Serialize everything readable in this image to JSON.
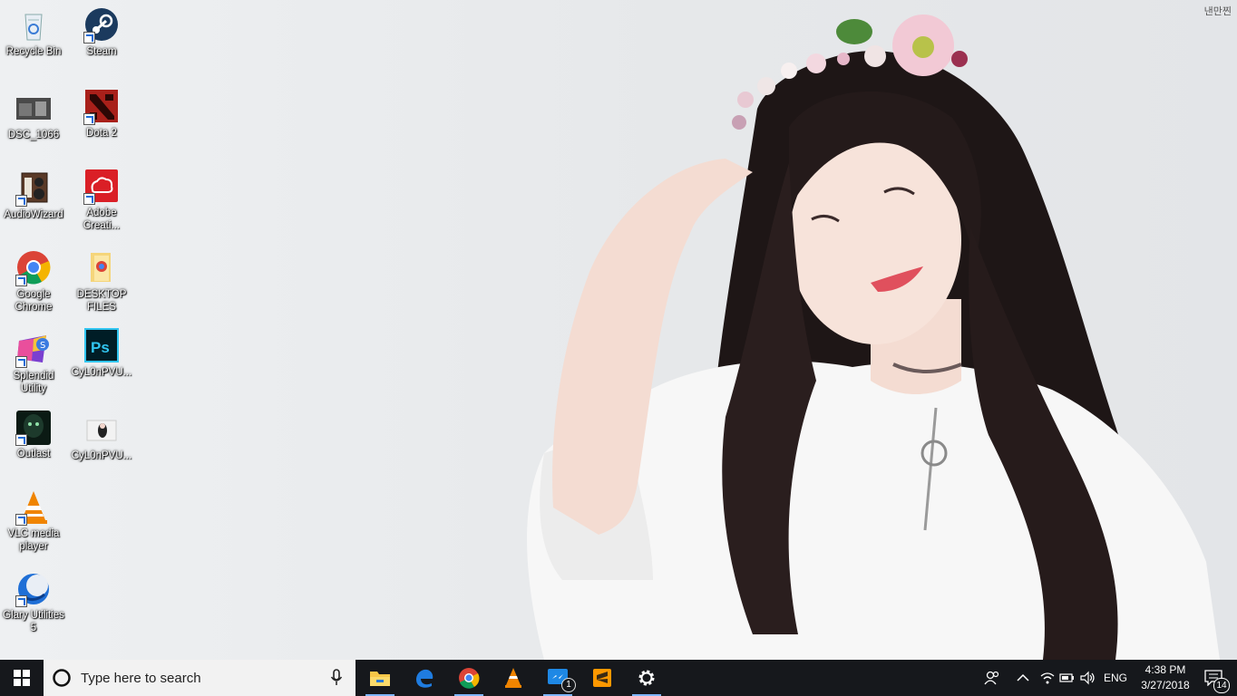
{
  "wallpaper": {
    "watermark": "낸만찐"
  },
  "desktop_icons": [
    {
      "label": "Recycle Bin",
      "icon": "recycle-bin-icon"
    },
    {
      "label": "Steam",
      "icon": "steam-icon"
    },
    {
      "label": "DSC_1066",
      "icon": "photo-thumbnail-icon"
    },
    {
      "label": "Dota 2",
      "icon": "dota2-icon"
    },
    {
      "label": "AudioWizard",
      "icon": "speaker-icon"
    },
    {
      "label": "Adobe Creati...",
      "icon": "adobe-cc-icon"
    },
    {
      "label": "Google Chrome",
      "icon": "chrome-icon"
    },
    {
      "label": "DESKTOP FILES",
      "icon": "folder-icon"
    },
    {
      "label": "Splendid Utility",
      "icon": "splendid-icon"
    },
    {
      "label": "CyL0nPVU...",
      "icon": "photoshop-icon"
    },
    {
      "label": "Outlast",
      "icon": "outlast-icon"
    },
    {
      "label": "CyL0nPVU...",
      "icon": "image-thumbnail-icon"
    },
    {
      "label": "VLC media player",
      "icon": "vlc-icon"
    },
    {
      "label": "Glary Utilities 5",
      "icon": "glary-icon"
    }
  ],
  "taskbar": {
    "search_placeholder": "Type here to search",
    "pinned": [
      "file-explorer-icon",
      "edge-icon",
      "chrome-icon",
      "vlc-icon",
      "messenger-icon",
      "sublime-text-icon",
      "settings-icon"
    ],
    "messenger_badge": "1",
    "language": "ENG",
    "time": "4:38 PM",
    "date": "3/27/2018",
    "notification_count": "14"
  },
  "colors": {
    "taskbar": "#16181c",
    "accent": "#7eb6ff",
    "search_bg": "#f2f2f2"
  }
}
